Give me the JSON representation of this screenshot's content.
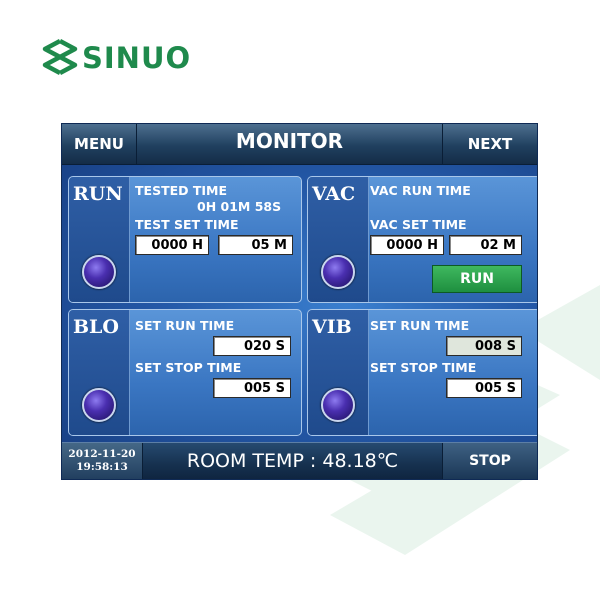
{
  "brand": {
    "name": "SINUO",
    "color": "#1f8a4c"
  },
  "header": {
    "menu_label": "MENU",
    "title": "MONITOR",
    "next_label": "NEXT"
  },
  "panels": {
    "run": {
      "tag": "RUN",
      "tested_time_label": "TESTED TIME",
      "tested_time_value": "0H 01M 58S",
      "test_set_time_label": "TEST SET TIME",
      "set_hours": "0000 H",
      "set_minutes": "05 M",
      "lamp": "indicator-lamp"
    },
    "vac": {
      "tag": "VAC",
      "run_time_label": "VAC RUN TIME",
      "set_time_label": "VAC SET TIME",
      "set_hours": "0000 H",
      "set_minutes": "02 M",
      "run_button": "RUN",
      "run_button_color": "#1e8f3f",
      "lamp": "indicator-lamp"
    },
    "blo": {
      "tag": "BLO",
      "set_run_time_label": "SET RUN TIME",
      "set_run_time_value": "020 S",
      "set_stop_time_label": "SET STOP TIME",
      "set_stop_time_value": "005 S",
      "lamp": "indicator-lamp"
    },
    "vib": {
      "tag": "VIB",
      "set_run_time_label": "SET RUN TIME",
      "set_run_time_value": "008 S",
      "set_stop_time_label": "SET STOP TIME",
      "set_stop_time_value": "005 S",
      "lamp": "indicator-lamp"
    }
  },
  "footer": {
    "date": "2012-11-20",
    "time": "19:58:13",
    "room_temp": "ROOM TEMP : 48.18℃",
    "stop_label": "STOP"
  }
}
